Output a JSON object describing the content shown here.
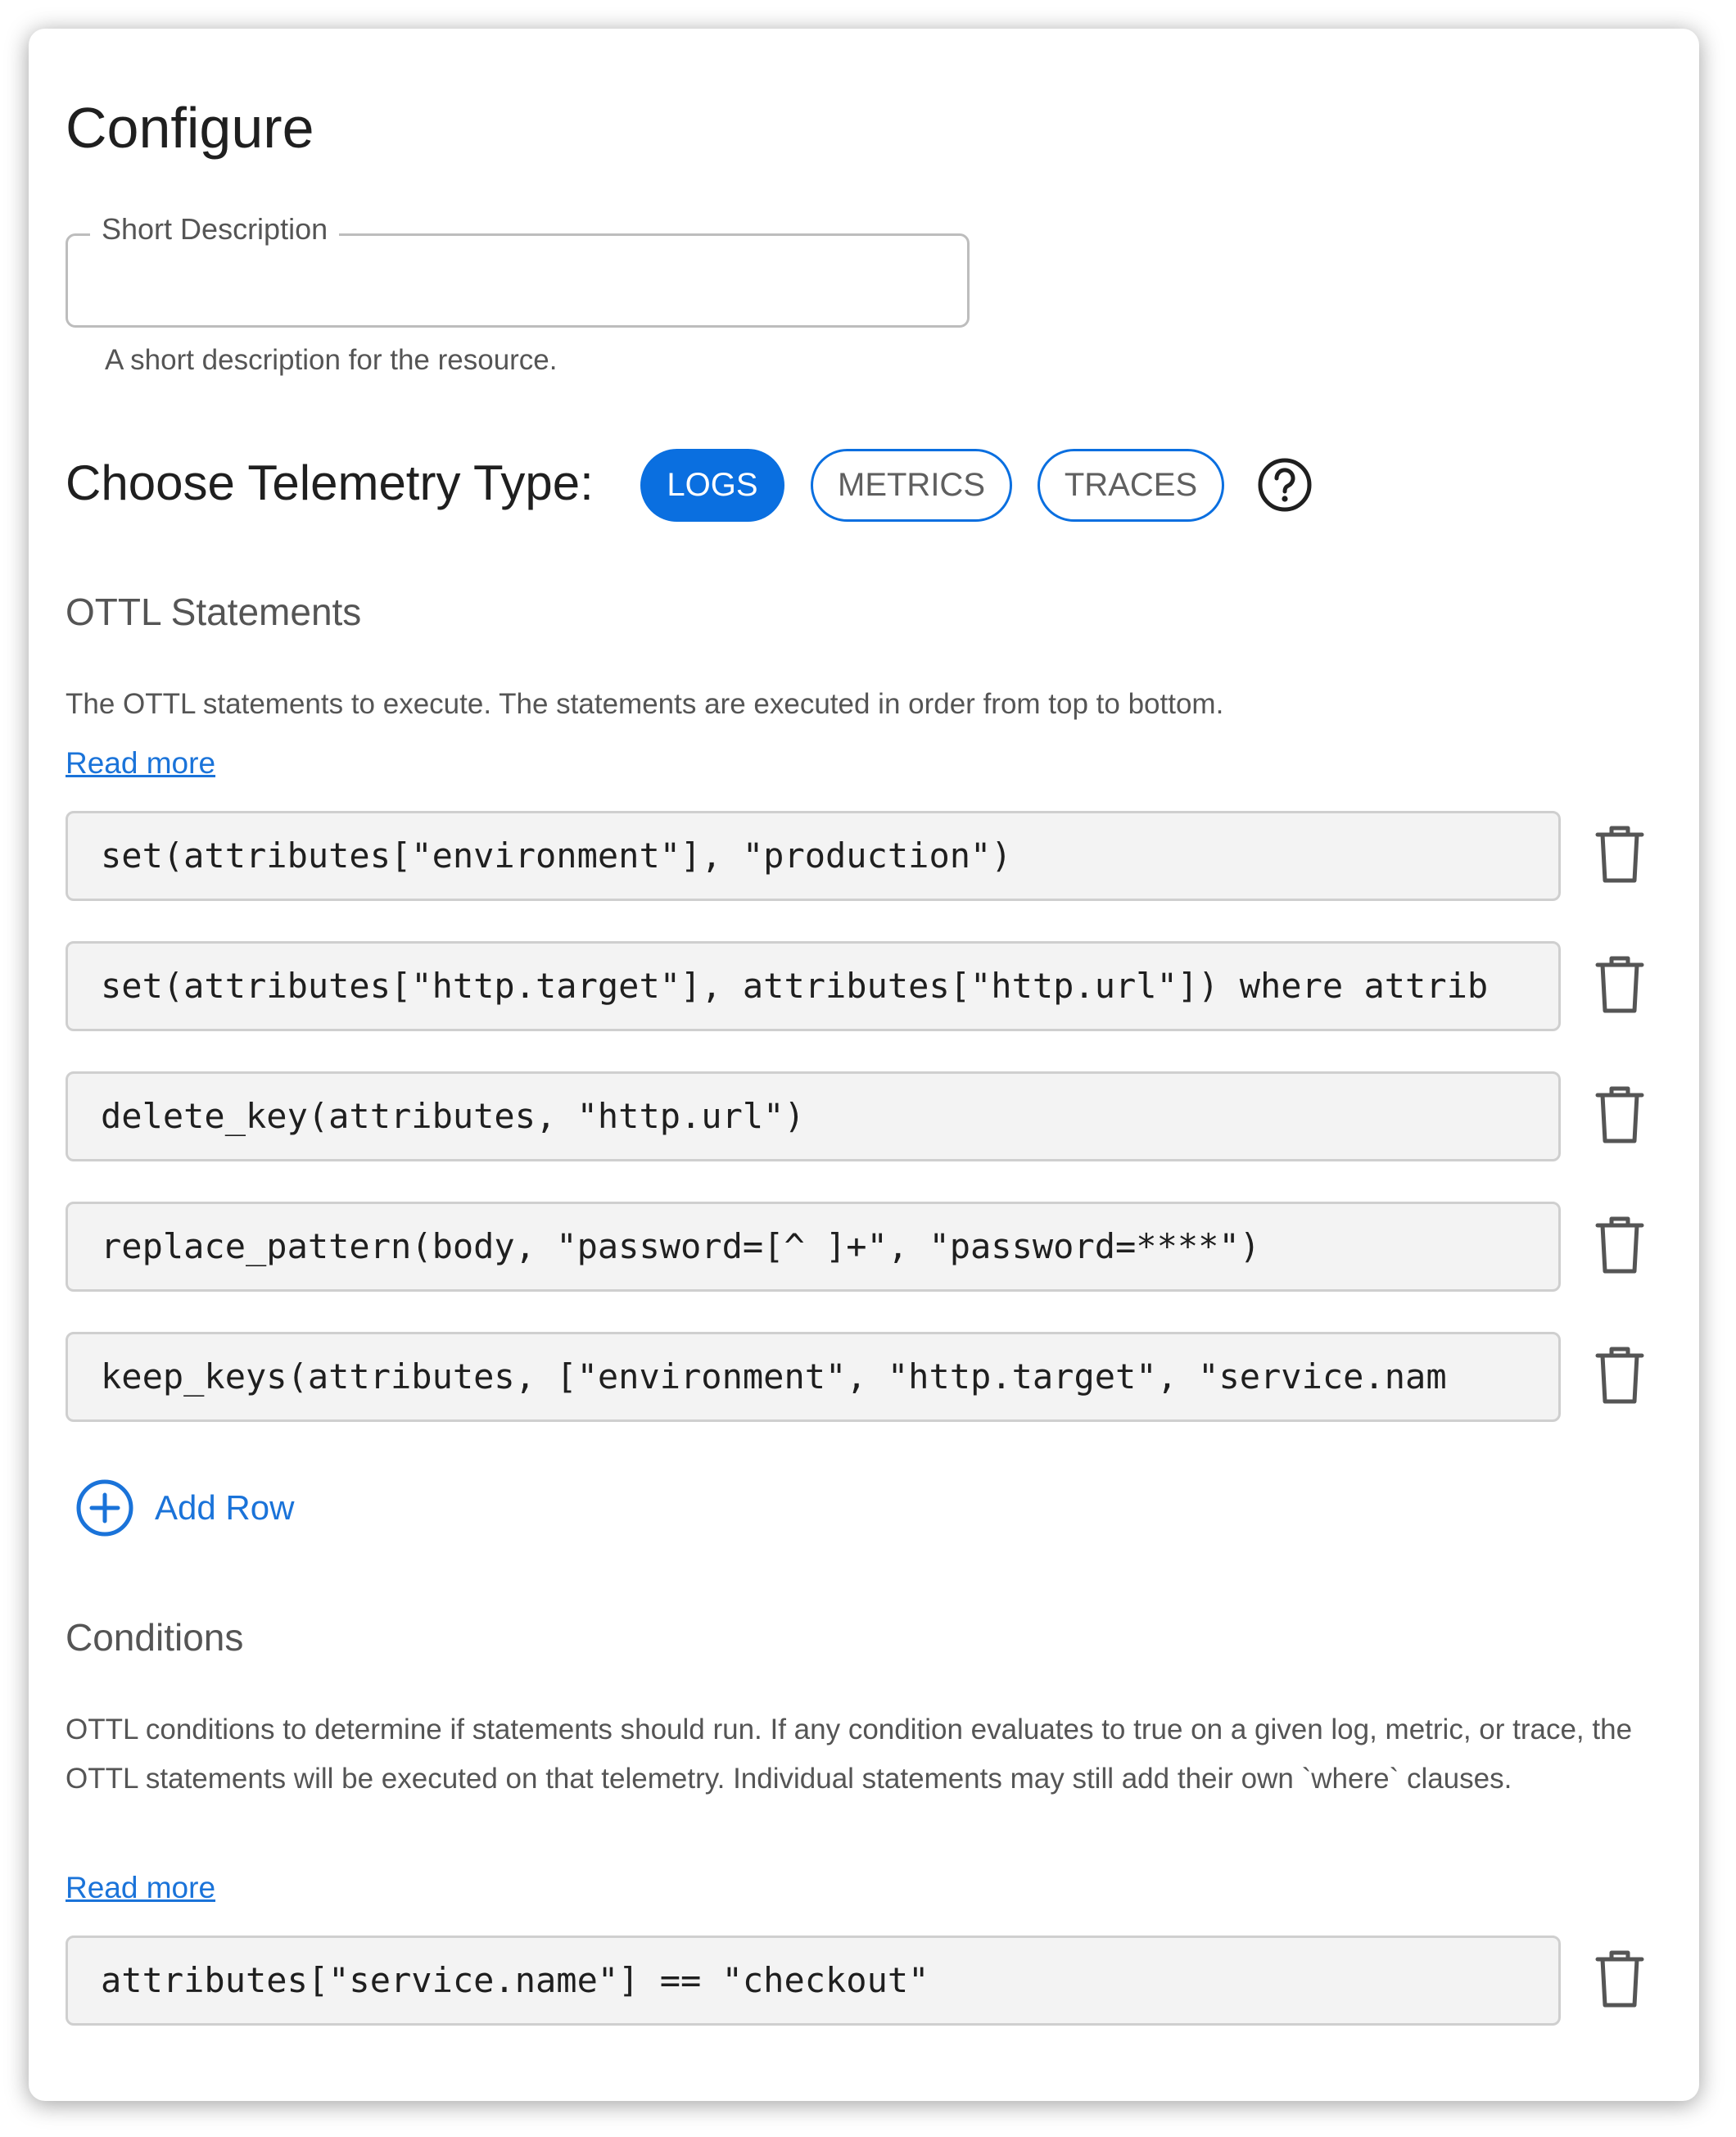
{
  "title": "Configure",
  "short_description": {
    "label": "Short Description",
    "value": "",
    "helper": "A short description for the resource."
  },
  "telemetry": {
    "label": "Choose Telemetry Type:",
    "options": [
      "LOGS",
      "METRICS",
      "TRACES"
    ],
    "selected": "LOGS"
  },
  "statements": {
    "title": "OTTL Statements",
    "description": "The OTTL statements to execute. The statements are executed in order from top to bottom.",
    "read_more": "Read more",
    "rows": [
      "set(attributes[\"environment\"], \"production\")",
      "set(attributes[\"http.target\"], attributes[\"http.url\"]) where attrib",
      "delete_key(attributes, \"http.url\")",
      "replace_pattern(body, \"password=[^ ]+\", \"password=****\")",
      "keep_keys(attributes, [\"environment\", \"http.target\", \"service.nam"
    ],
    "add_row": "Add Row"
  },
  "conditions": {
    "title": "Conditions",
    "description": "OTTL conditions to determine if statements should run. If any condition evaluates to true on a given log, metric, or trace, the OTTL statements will be executed on that telemetry. Individual statements may still add their own `where` clauses.",
    "read_more": "Read more",
    "rows": [
      "attributes[\"service.name\"] == \"checkout\""
    ]
  },
  "colors": {
    "accent": "#0a6fe0",
    "link": "#1a73d9",
    "input_bg": "#f3f3f3"
  }
}
